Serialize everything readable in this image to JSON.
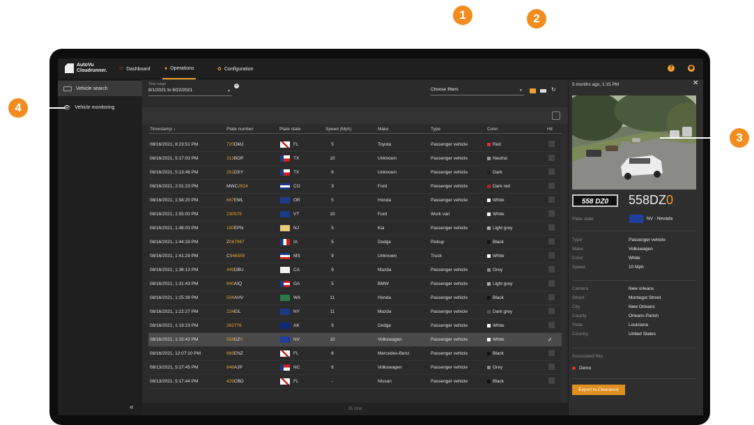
{
  "app": {
    "logo_text": "AutoVu\nCloudrunner."
  },
  "nav": [
    {
      "label": "Dashboard"
    },
    {
      "label": "Operations"
    },
    {
      "label": "Configuration"
    }
  ],
  "sidebar": {
    "items": [
      {
        "label": "Vehicle search"
      },
      {
        "label": "Vehicle monitoring"
      }
    ],
    "collapse_glyph": "«"
  },
  "filters": {
    "time_range_label": "Time range",
    "time_range_value": "8/1/2021 to 8/22/2021",
    "choose_filters": "Choose filters"
  },
  "table": {
    "headers": [
      "Timestamp ↓",
      "Plate number",
      "Plate state",
      "Speed (Mph)",
      "Make",
      "Type",
      "Color",
      "Hit"
    ],
    "rows": [
      {
        "ts": "08/16/2021, 8:23:51 PM",
        "pl_hl": "720",
        "pl": "DMJ",
        "st": "FL",
        "flag": "fl",
        "sp": "5",
        "mk": "Toyota",
        "ty": "Passenger vehicle",
        "co": "Red",
        "sw": "#e03030",
        "sel": false
      },
      {
        "ts": "08/16/2021, 5:17:03 PM",
        "pl_hl": "313",
        "pl": "BOP",
        "st": "TX",
        "flag": "tx",
        "sp": "10",
        "mk": "Unknown",
        "ty": "Passenger vehicle",
        "co": "Neutral",
        "sw": "#999999",
        "sel": false
      },
      {
        "ts": "08/16/2021, 5:13:46 PM",
        "pl_hl": "261",
        "pl": "DSY",
        "st": "TX",
        "flag": "tx",
        "sp": "6",
        "mk": "Unknown",
        "ty": "Passenger vehicle",
        "co": "Dark",
        "sw": "#222222",
        "sel": false
      },
      {
        "ts": "08/16/2021, 2:01:23 PM",
        "pl_hl": "",
        "pl": "MWC",
        "pl_hl2": "2924",
        "st": "CO",
        "flag": "co",
        "sp": "3",
        "mk": "Ford",
        "ty": "Passenger vehicle",
        "co": "Dark red",
        "sw": "#b02020",
        "sel": false
      },
      {
        "ts": "08/16/2021, 1:58:20 PM",
        "pl_hl": "667",
        "pl": "EML",
        "st": "OR",
        "flag": "or",
        "sp": "5",
        "mk": "Honda",
        "ty": "Passenger vehicle",
        "co": "White",
        "sw": "#ffffff",
        "sel": false
      },
      {
        "ts": "08/16/2021, 1:55:00 PM",
        "pl_hl": "230579",
        "pl": "",
        "st": "VT",
        "flag": "vt",
        "sp": "10",
        "mk": "Ford",
        "ty": "Work van",
        "co": "White",
        "sw": "#ffffff",
        "sel": false
      },
      {
        "ts": "08/16/2021, 1:48:03 PM",
        "pl_hl": "190",
        "pl": "EPN",
        "st": "NJ",
        "flag": "nj",
        "sp": "5",
        "mk": "Kia",
        "ty": "Passenger vehicle",
        "co": "Light grey",
        "sw": "#aaaaaa",
        "sel": false
      },
      {
        "ts": "08/16/2021, 1:44:33 PM",
        "pl_hl": "",
        "pl": "Z",
        "pl_hl2": "067967",
        "st": "IA",
        "flag": "ia",
        "sp": "5",
        "mk": "Dodge",
        "ty": "Pickup",
        "co": "Black",
        "sw": "#111111",
        "sel": false
      },
      {
        "ts": "08/16/2021, 1:41:29 PM",
        "pl_hl": "",
        "pl": "C",
        "pl_hl2": "946559",
        "st": "MS",
        "flag": "ms",
        "sp": "9",
        "mk": "Unknown",
        "ty": "Truck",
        "co": "White",
        "sw": "#ffffff",
        "sel": false
      },
      {
        "ts": "08/16/2021, 1:36:13 PM",
        "pl_hl": "449",
        "pl": "DBU",
        "st": "CA",
        "flag": "ca",
        "sp": "9",
        "mk": "Mazda",
        "ty": "Passenger vehicle",
        "co": "Grey",
        "sw": "#888888",
        "sel": false
      },
      {
        "ts": "08/16/2021, 1:31:43 PM",
        "pl_hl": "940",
        "pl": "AIQ",
        "st": "GA",
        "flag": "ga",
        "sp": "5",
        "mk": "BMW",
        "ty": "Passenger vehicle",
        "co": "Light grey",
        "sw": "#aaaaaa",
        "sel": false
      },
      {
        "ts": "08/16/2021, 1:25:39 PM",
        "pl_hl": "504",
        "pl": "AHV",
        "st": "WA",
        "flag": "wa",
        "sp": "11",
        "mk": "Honda",
        "ty": "Passenger vehicle",
        "co": "Black",
        "sw": "#111111",
        "sel": false
      },
      {
        "ts": "08/16/2021, 1:22:27 PM",
        "pl_hl": "224",
        "pl": "EIL",
        "st": "NY",
        "flag": "ny",
        "sp": "11",
        "mk": "Mazda",
        "ty": "Passenger vehicle",
        "co": "Dark grey",
        "sw": "#555555",
        "sel": false
      },
      {
        "ts": "08/16/2021, 1:19:23 PM",
        "pl_hl": "262776",
        "pl": "",
        "st": "AK",
        "flag": "ak",
        "sp": "9",
        "mk": "Dodge",
        "ty": "Passenger vehicle",
        "co": "White",
        "sw": "#ffffff",
        "sel": false
      },
      {
        "ts": "08/16/2021, 1:15:42 PM",
        "pl_hl": "558",
        "pl": "DZ",
        "pl_hl2": "0",
        "st": "NV",
        "flag": "nv",
        "sp": "10",
        "mk": "Volkswagen",
        "ty": "Passenger vehicle",
        "co": "White",
        "sw": "#ffffff",
        "sel": true
      },
      {
        "ts": "08/16/2021, 12:07:10 PM",
        "pl_hl": "669",
        "pl": "ENZ",
        "st": "FL",
        "flag": "fl",
        "sp": "6",
        "mk": "Mercedes-Benz",
        "ty": "Passenger vehicle",
        "co": "Black",
        "sw": "#111111",
        "sel": false
      },
      {
        "ts": "08/13/2021, 5:27:45 PM",
        "pl_hl": "846",
        "pl": "AJP",
        "st": "NC",
        "flag": "nc",
        "sp": "6",
        "mk": "Volkswagen",
        "ty": "Passenger vehicle",
        "co": "Grey",
        "sw": "#888888",
        "sel": false
      },
      {
        "ts": "08/13/2021, 5:17:44 PM",
        "pl_hl": "429",
        "pl": "CBD",
        "st": "FL",
        "flag": "fl",
        "sp": "-",
        "mk": "Nissan",
        "ty": "Passenger vehicle",
        "co": "Black",
        "sw": "#111111",
        "sel": false
      }
    ],
    "total": "35 total"
  },
  "details": {
    "time": "5 months ago, 1:15 PM",
    "plate_crop": "558 DZ0",
    "plate_main": "558DZ",
    "plate_main_hl": "0",
    "plate_state_label": "Plate state",
    "plate_state_value": "NV - Nevada",
    "fields1": [
      {
        "k": "Type",
        "v": "Passenger vehicle"
      },
      {
        "k": "Make",
        "v": "Volkswagen"
      },
      {
        "k": "Color",
        "v": "White"
      },
      {
        "k": "Speed",
        "v": "10 Mph"
      }
    ],
    "fields2": [
      {
        "k": "Camera",
        "v": "New orleans"
      },
      {
        "k": "Street",
        "v": "Montegut Street"
      },
      {
        "k": "City",
        "v": "New Orleans"
      },
      {
        "k": "County",
        "v": "Orleans Parish"
      },
      {
        "k": "State",
        "v": "Louisiana"
      },
      {
        "k": "Country",
        "v": "United States"
      }
    ],
    "hits_label": "Associated hits",
    "hit": "Demo",
    "export_button": "Export to Clearance"
  },
  "callouts": [
    "1",
    "2",
    "3",
    "4"
  ],
  "colors": {
    "accent": "#f0a030",
    "callout": "#f28c1e"
  }
}
